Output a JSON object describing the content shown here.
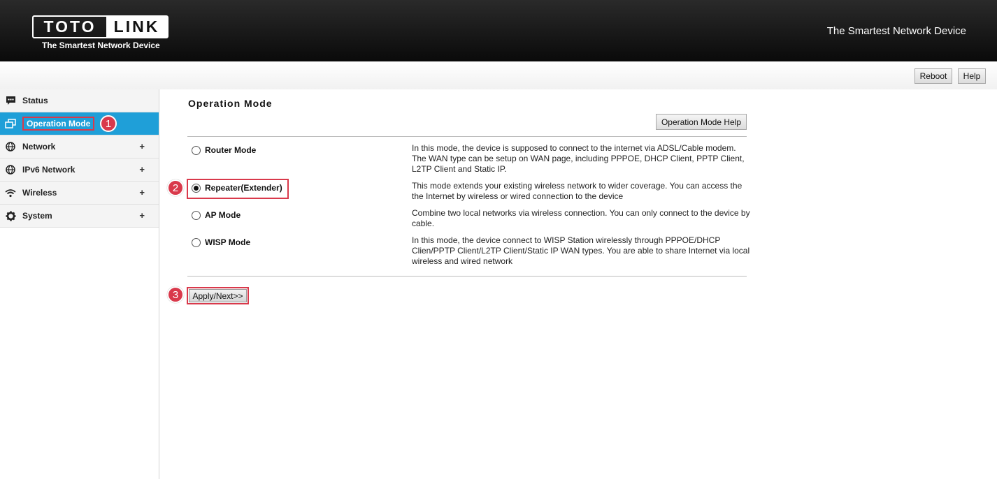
{
  "header": {
    "logo_left": "TOTO",
    "logo_right": "LINK",
    "logo_tagline": "The Smartest Network Device",
    "slogan": "The Smartest Network Device"
  },
  "topbar": {
    "reboot_label": "Reboot",
    "help_label": "Help"
  },
  "sidebar": {
    "items": [
      {
        "label": "Status",
        "icon": "chat-icon",
        "expandable": false,
        "active": false
      },
      {
        "label": "Operation Mode",
        "icon": "windows-icon",
        "expandable": false,
        "active": true
      },
      {
        "label": "Network",
        "icon": "globe-icon",
        "expandable": true,
        "plus": "+"
      },
      {
        "label": "IPv6 Network",
        "icon": "globe-icon",
        "expandable": true,
        "plus": "+"
      },
      {
        "label": "Wireless",
        "icon": "wifi-icon",
        "expandable": true,
        "plus": "+"
      },
      {
        "label": "System",
        "icon": "gear-icon",
        "expandable": true,
        "plus": "+"
      }
    ]
  },
  "annotations": {
    "step1": "1",
    "step2": "2",
    "step3": "3",
    "color": "#d9394b"
  },
  "main": {
    "title": "Operation Mode",
    "help_button": "Operation Mode Help",
    "modes": [
      {
        "label": "Router Mode",
        "checked": false,
        "description": "In this mode, the device is supposed to connect to the internet via ADSL/Cable modem. The WAN type can be setup on WAN page, including PPPOE, DHCP Client, PPTP Client, L2TP Client and Static IP."
      },
      {
        "label": "Repeater(Extender)",
        "checked": true,
        "description": "This mode extends your existing wireless network to wider coverage. You can access the the Internet by wireless or wired connection to the device"
      },
      {
        "label": "AP Mode",
        "checked": false,
        "description": "Combine two local networks via wireless connection. You can only connect to the device by cable."
      },
      {
        "label": "WISP Mode",
        "checked": false,
        "description": "In this mode, the device connect to WISP Station wirelessly through PPPOE/DHCP Clien/PPTP Client/L2TP Client/Static IP WAN types. You are able to share Internet via local wireless and wired network"
      }
    ],
    "apply_button": "Apply/Next>>"
  },
  "colors": {
    "active_nav": "#1f9fd8",
    "header_bg": "#111111"
  }
}
